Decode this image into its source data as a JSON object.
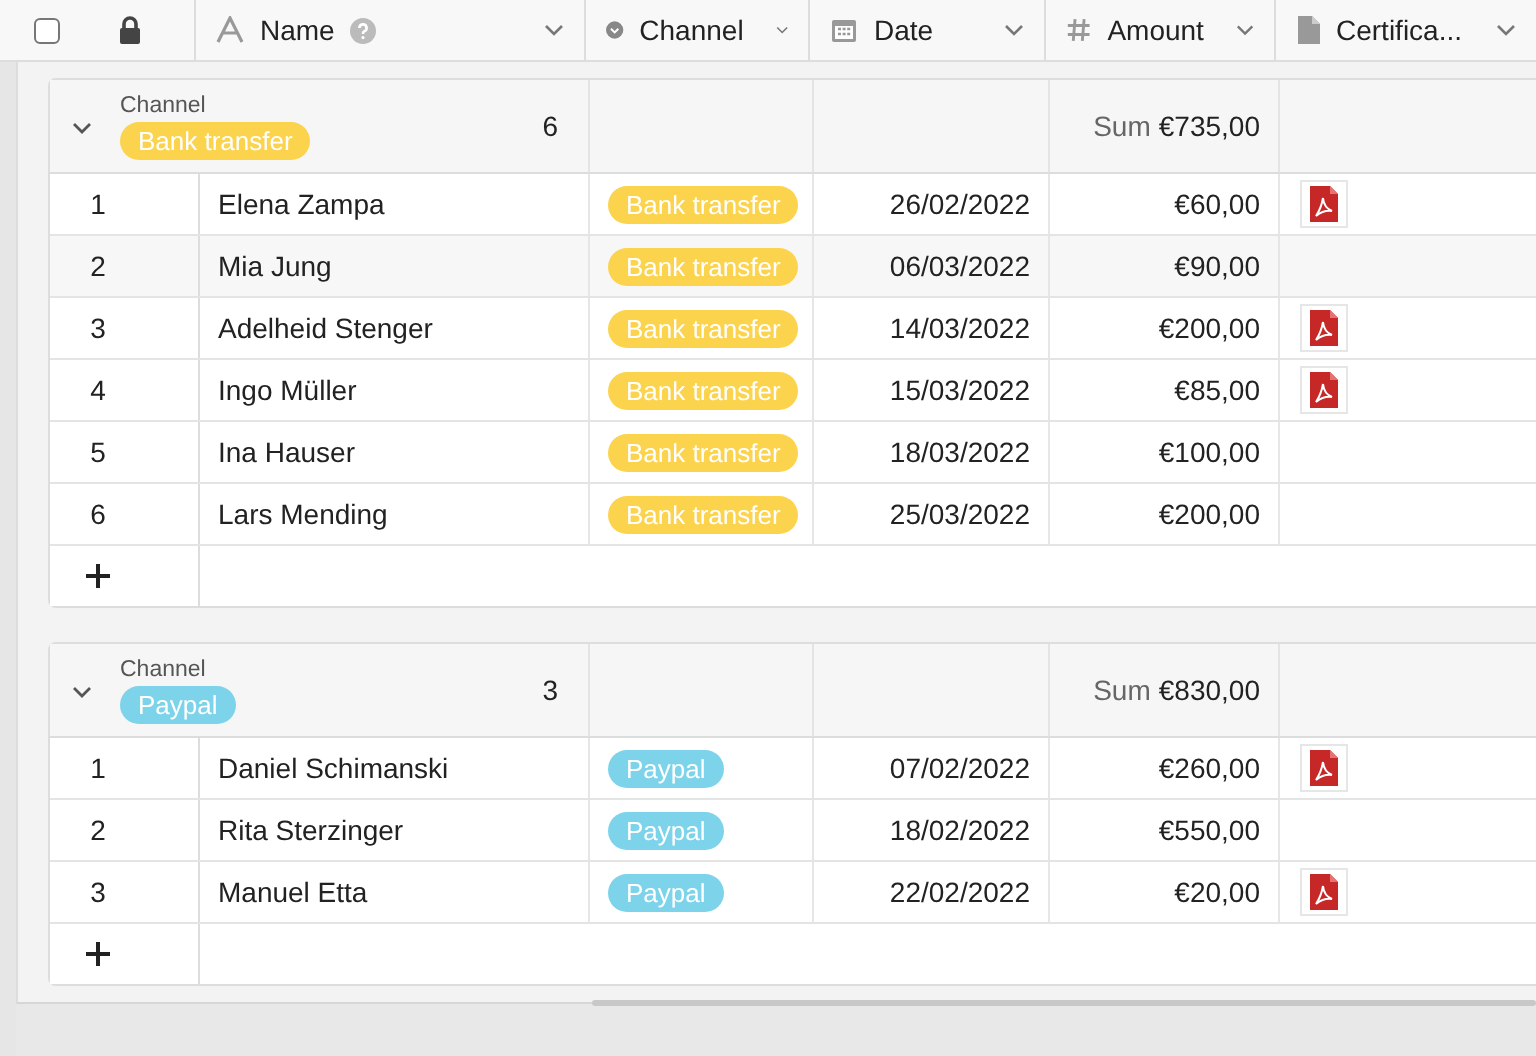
{
  "select_all": {
    "checked": false
  },
  "columns": [
    {
      "kind": "text",
      "label": "Name",
      "help": true
    },
    {
      "kind": "select",
      "label": "Channel",
      "help": false
    },
    {
      "kind": "date",
      "label": "Date",
      "help": false
    },
    {
      "kind": "number",
      "label": "Amount",
      "help": false
    },
    {
      "kind": "file",
      "label": "Certifica...",
      "help": false
    }
  ],
  "groups": [
    {
      "field": "Channel",
      "value": "Bank transfer",
      "color": "#fcd34d",
      "count": "6",
      "sum_label": "Sum",
      "sum": "€735,00",
      "expanded": true,
      "rows": [
        {
          "num": "1",
          "name": "Elena Zampa",
          "channel": "Bank transfer",
          "date": "26/02/2022",
          "amount": "€60,00",
          "certificate": true,
          "highlighted": false
        },
        {
          "num": "2",
          "name": "Mia Jung",
          "channel": "Bank transfer",
          "date": "06/03/2022",
          "amount": "€90,00",
          "certificate": false,
          "highlighted": true
        },
        {
          "num": "3",
          "name": "Adelheid Stenger",
          "channel": "Bank transfer",
          "date": "14/03/2022",
          "amount": "€200,00",
          "certificate": true,
          "highlighted": false
        },
        {
          "num": "4",
          "name": "Ingo Müller",
          "channel": "Bank transfer",
          "date": "15/03/2022",
          "amount": "€85,00",
          "certificate": true,
          "highlighted": false
        },
        {
          "num": "5",
          "name": "Ina Hauser",
          "channel": "Bank transfer",
          "date": "18/03/2022",
          "amount": "€100,00",
          "certificate": false,
          "highlighted": false
        },
        {
          "num": "6",
          "name": "Lars Mending",
          "channel": "Bank transfer",
          "date": "25/03/2022",
          "amount": "€200,00",
          "certificate": false,
          "highlighted": false
        }
      ]
    },
    {
      "field": "Channel",
      "value": "Paypal",
      "color": "#7dd3ea",
      "count": "3",
      "sum_label": "Sum",
      "sum": "€830,00",
      "expanded": true,
      "rows": [
        {
          "num": "1",
          "name": "Daniel Schimanski",
          "channel": "Paypal",
          "date": "07/02/2022",
          "amount": "€260,00",
          "certificate": true,
          "highlighted": false
        },
        {
          "num": "2",
          "name": "Rita Sterzinger",
          "channel": "Paypal",
          "date": "18/02/2022",
          "amount": "€550,00",
          "certificate": false,
          "highlighted": false
        },
        {
          "num": "3",
          "name": "Manuel Etta",
          "channel": "Paypal",
          "date": "22/02/2022",
          "amount": "€20,00",
          "certificate": true,
          "highlighted": false
        }
      ]
    }
  ]
}
